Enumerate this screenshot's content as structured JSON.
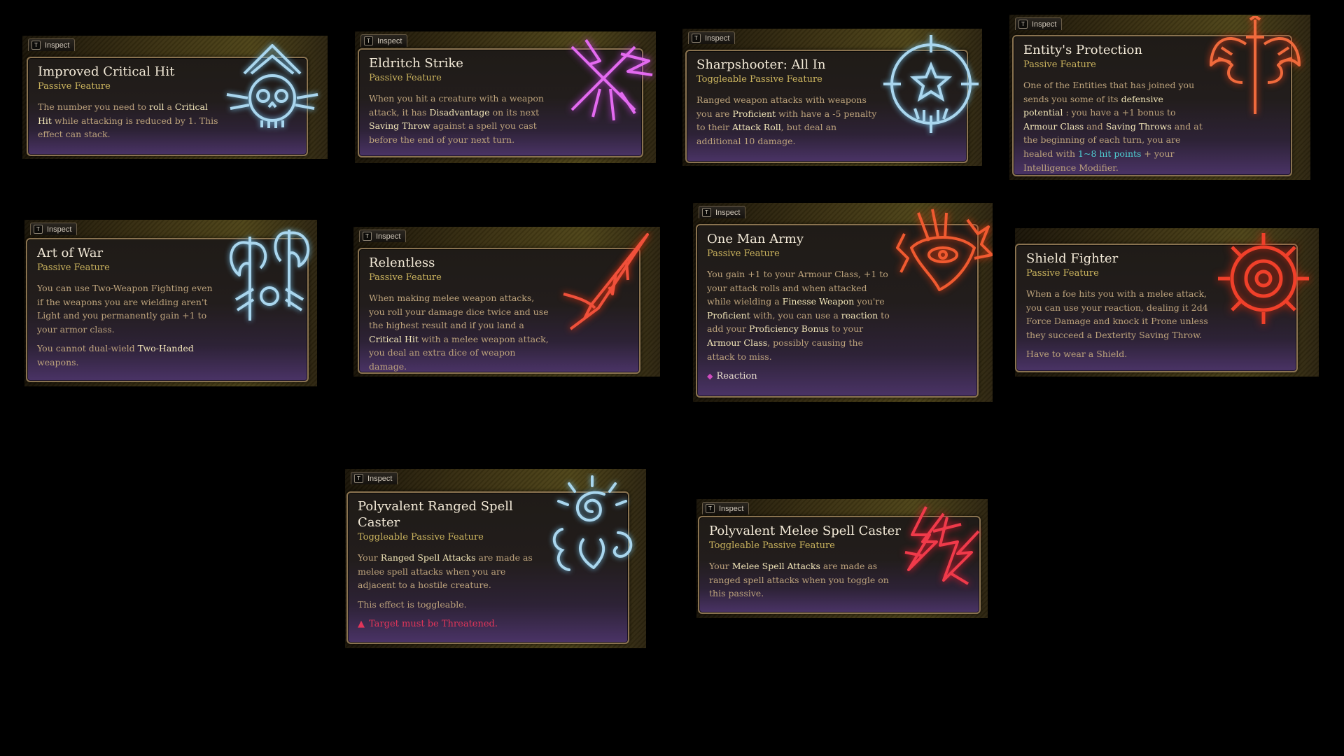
{
  "inspect_label": "Inspect",
  "inspect_key": "T",
  "cards": [
    {
      "title": "Improved Critical Hit",
      "subtitle": "Passive Feature",
      "icon": "skull-crown-icon",
      "icon_color": "#a9d6ee",
      "desc": [
        [
          "The number you need to ",
          "roll",
          " a ",
          "Critical Hit",
          " while attacking is reduced by 1. This effect can stack."
        ]
      ]
    },
    {
      "title": "Eldritch Strike",
      "subtitle": "Passive Feature",
      "icon": "crossed-blades-icon",
      "icon_color": "#e36af0",
      "desc": [
        [
          "When you hit a creature with a weapon attack, it has ",
          "Disadvantage",
          " on its next ",
          "Saving Throw",
          " against a spell you cast before the end of your next turn."
        ]
      ]
    },
    {
      "title": "Sharpshooter: All In",
      "subtitle": "Toggleable Passive Feature",
      "icon": "crosshair-icon",
      "icon_color": "#a9d6ee",
      "desc": [
        [
          "Ranged weapon attacks with weapons you are ",
          "Proficient",
          " with have a -5 penalty to their ",
          "Attack Roll",
          ", but deal an additional 10 damage."
        ]
      ]
    },
    {
      "title": "Entity's Protection",
      "subtitle": "Passive Feature",
      "icon": "winged-sword-icon",
      "icon_color": "#f06a3c",
      "desc": [
        [
          "One of the Entities that has joined you sends you some of its ",
          "defensive potential",
          " : you have a +1 bonus to ",
          "Armour Class",
          " and ",
          "Saving Throws",
          " and at the beginning of each turn, you are healed with ",
          "1~8 hit points",
          " + your Intelligence Modifier."
        ]
      ]
    },
    {
      "title": "Art of War",
      "subtitle": "Passive Feature",
      "icon": "double-axe-icon",
      "icon_color": "#a9d6ee",
      "desc": [
        [
          "You can use Two-Weapon Fighting even if the weapons you are wielding aren't Light and you permanently gain +1 to your armor class."
        ],
        [
          "You cannot dual-wield ",
          "Two-Handed",
          " weapons."
        ]
      ]
    },
    {
      "title": "Relentless",
      "subtitle": "Passive Feature",
      "icon": "bloody-blade-icon",
      "icon_color": "#f0503a",
      "desc": [
        [
          "When making melee weapon attacks, you roll your damage dice twice and use the highest result and if you land a ",
          "Critical Hit",
          " with a melee weapon attack, you deal an extra dice of weapon damage."
        ]
      ]
    },
    {
      "title": "One Man Army",
      "subtitle": "Passive Feature",
      "icon": "eye-helm-icon",
      "icon_color": "#f05a30",
      "desc": [
        [
          "You gain +1 to your Armour Class, +1 to your attack rolls and when attacked while wielding a ",
          "Finesse Weapon",
          " you're ",
          "Proficient",
          " with, you can use a ",
          "reaction",
          " to add your ",
          "Proficiency Bonus",
          " to your ",
          "Armour Class",
          ", possibly causing the attack to miss."
        ]
      ],
      "footer": "Reaction"
    },
    {
      "title": "Shield Fighter",
      "subtitle": "Passive Feature",
      "icon": "shield-sun-icon",
      "icon_color": "#f0402a",
      "desc": [
        [
          "When a foe hits you with a melee attack, you can use your reaction, dealing it 2d4 Force Damage and knock it Prone unless they succeed a Dexterity Saving Throw."
        ],
        [
          "Have to wear a Shield."
        ]
      ]
    },
    {
      "title": "Polyvalent Ranged Spell Caster",
      "subtitle": "Toggleable Passive Feature",
      "icon": "spiral-magic-icon",
      "icon_color": "#a9d6ee",
      "desc": [
        [
          "Your ",
          "Ranged Spell Attacks",
          " are made as melee spell attacks when you are adjacent to a hostile creature."
        ],
        [
          "This effect is toggleable."
        ]
      ],
      "warning": "Target must be Threatened."
    },
    {
      "title": "Polyvalent Melee Spell Caster",
      "subtitle": "Toggleable Passive Feature",
      "icon": "lightning-icon",
      "icon_color": "#f03a4a",
      "desc": [
        [
          "Your ",
          "Melee Spell Attacks",
          " are made as ranged spell attacks when you toggle on this passive."
        ]
      ]
    }
  ]
}
